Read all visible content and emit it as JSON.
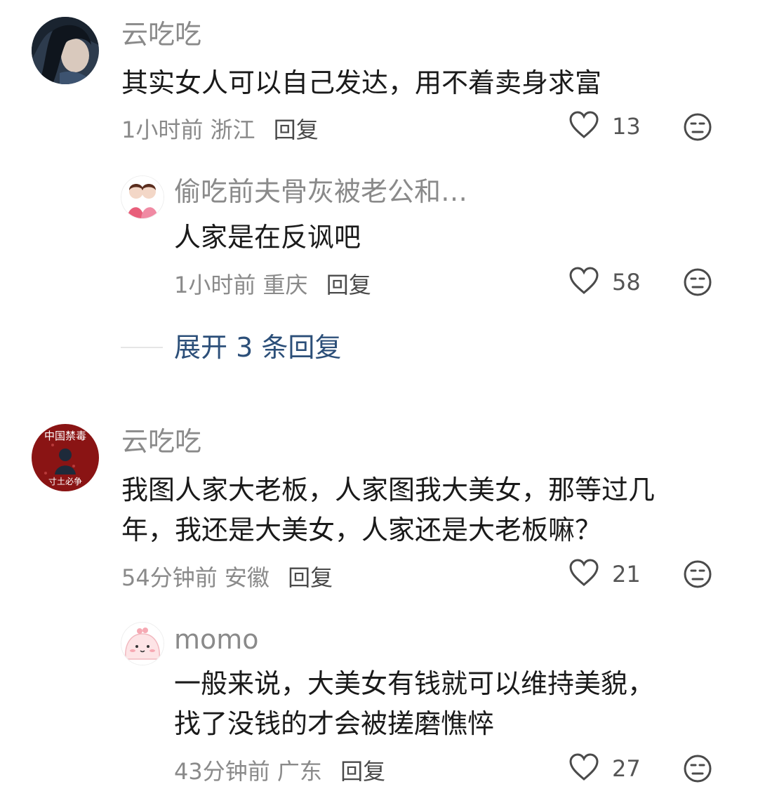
{
  "comments": [
    {
      "username": "云吃吃",
      "text": "其实女人可以自己发达，用不着卖身求富",
      "time": "1小时前",
      "location": "浙江",
      "reply_label": "回复",
      "likes": "13",
      "replies": [
        {
          "username": "偷吃前夫骨灰被老公和…",
          "text": "人家是在反讽吧",
          "time": "1小时前",
          "location": "重庆",
          "reply_label": "回复",
          "likes": "58"
        }
      ],
      "expand_label": "展开 3 条回复"
    },
    {
      "username": "云吃吃",
      "avatar_text_top": "中国禁毒",
      "avatar_text_bottom": "寸土必争",
      "text_line1": "我图人家大老板，人家图我大美女，那等过几",
      "text_line2": "年，我还是大美女，人家还是大老板嘛？",
      "time": "54分钟前",
      "location": "安徽",
      "reply_label": "回复",
      "likes": "21",
      "replies": [
        {
          "username": "momo",
          "text_line1": "一般来说，大美女有钱就可以维持美貌，",
          "text_line2": "找了没钱的才会被搓磨憔悴",
          "time": "43分钟前",
          "location": "广东",
          "reply_label": "回复",
          "likes": "27"
        }
      ]
    }
  ],
  "icons": {
    "like": "heart-outline-icon",
    "dislike": "neutral-face-icon"
  },
  "colors": {
    "username": "#8a8a8a",
    "text": "#1a1a1a",
    "expand": "#2c4f79"
  }
}
